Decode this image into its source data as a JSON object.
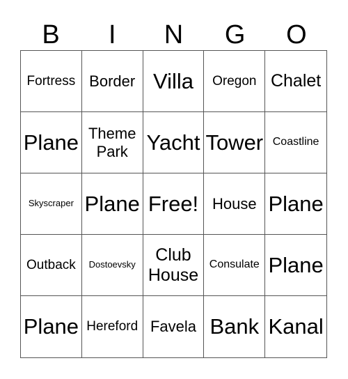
{
  "header": [
    "B",
    "I",
    "N",
    "G",
    "O"
  ],
  "cells": [
    {
      "text": "Fortress",
      "size": "s19"
    },
    {
      "text": "Border",
      "size": "s22"
    },
    {
      "text": "Villa",
      "size": "s28"
    },
    {
      "text": "Oregon",
      "size": "s19"
    },
    {
      "text": "Chalet",
      "size": "s24"
    },
    {
      "text": "Plane",
      "size": "s28"
    },
    {
      "text": "Theme Park",
      "size": "s22"
    },
    {
      "text": "Yacht",
      "size": "s28"
    },
    {
      "text": "Tower",
      "size": "s28"
    },
    {
      "text": "Coastline",
      "size": "s15"
    },
    {
      "text": "Skyscraper",
      "size": "s13"
    },
    {
      "text": "Plane",
      "size": "s28"
    },
    {
      "text": "Free!",
      "size": "s28"
    },
    {
      "text": "House",
      "size": "s22"
    },
    {
      "text": "Plane",
      "size": "s28"
    },
    {
      "text": "Outback",
      "size": "s19"
    },
    {
      "text": "Dostoevsky",
      "size": "s13"
    },
    {
      "text": "Club House",
      "size": "s24"
    },
    {
      "text": "Consulate",
      "size": "s15"
    },
    {
      "text": "Plane",
      "size": "s28"
    },
    {
      "text": "Plane",
      "size": "s28"
    },
    {
      "text": "Hereford",
      "size": "s19"
    },
    {
      "text": "Favela",
      "size": "s22"
    },
    {
      "text": "Bank",
      "size": "s28"
    },
    {
      "text": "Kanal",
      "size": "s28"
    }
  ]
}
